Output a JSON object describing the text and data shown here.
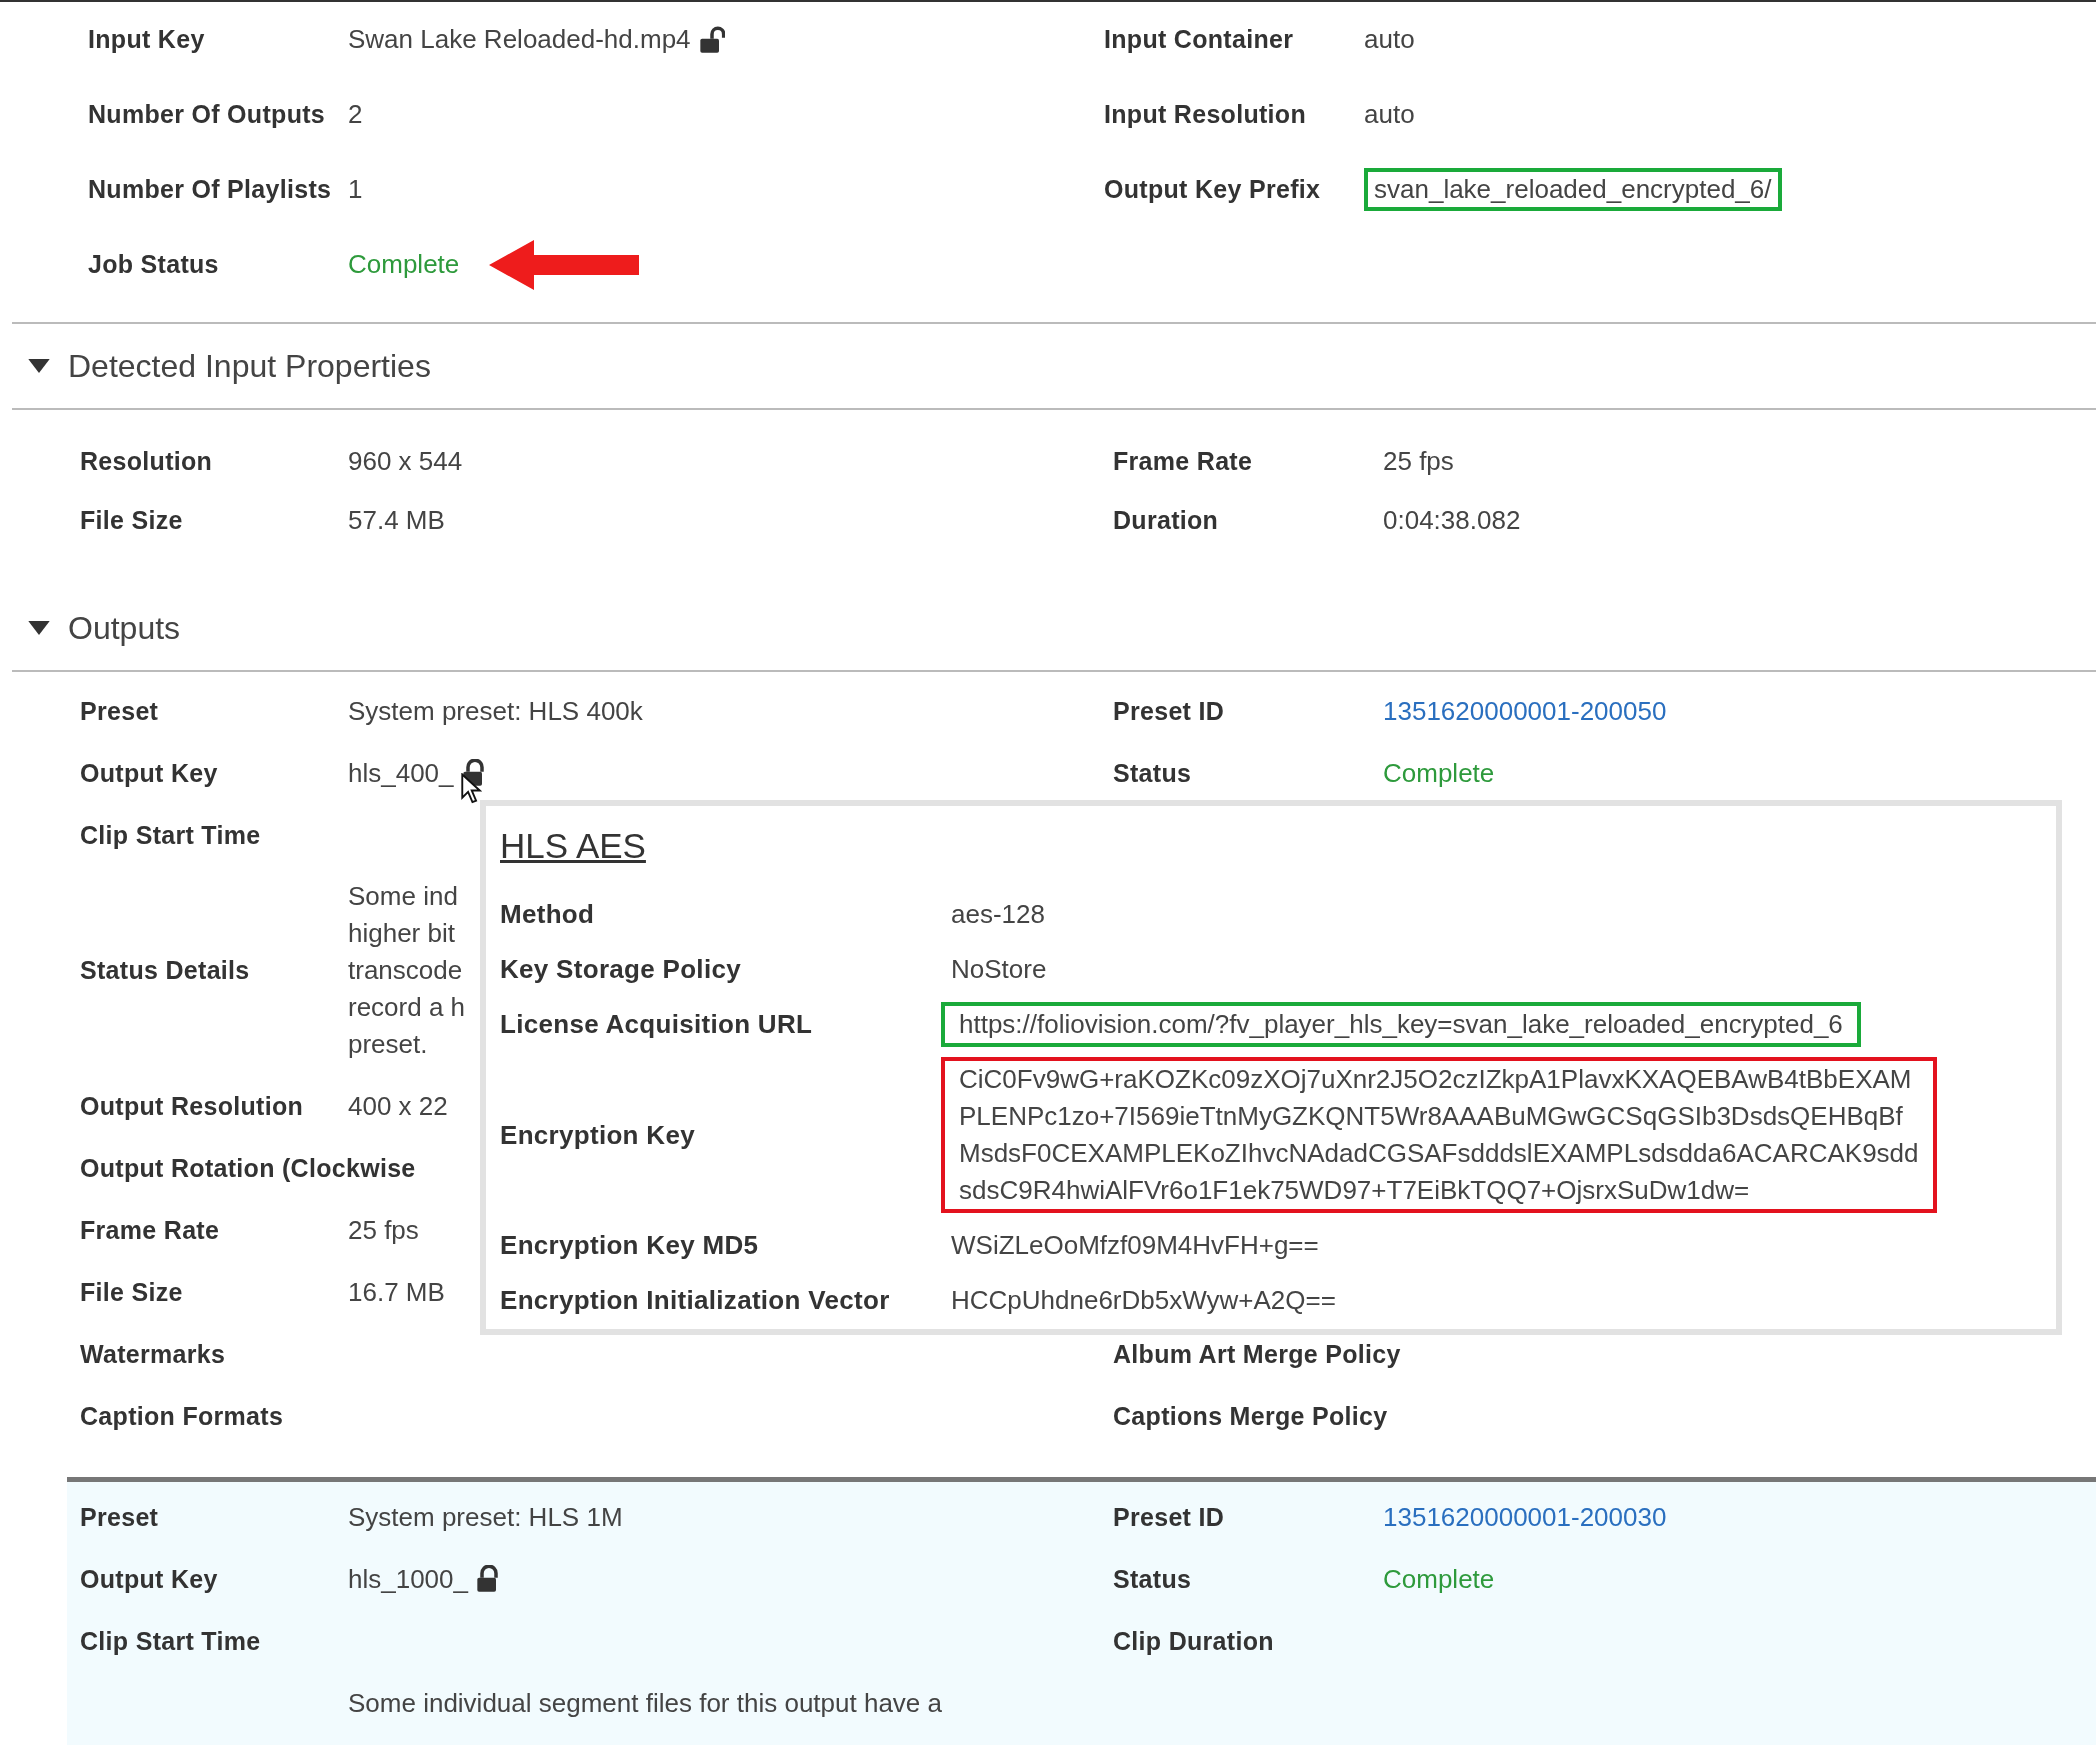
{
  "job": {
    "rows": [
      {
        "left": {
          "label": "Input Key",
          "value": "Swan Lake Reloaded-hd.mp4",
          "kind": "text",
          "lock": {
            "locked": false
          }
        },
        "right": {
          "label": "Input Container",
          "value": "auto",
          "kind": "text"
        }
      },
      {
        "left": {
          "label": "Number Of Outputs",
          "value": "2",
          "kind": "text"
        },
        "right": {
          "label": "Input Resolution",
          "value": "auto",
          "kind": "text"
        }
      },
      {
        "left": {
          "label": "Number Of Playlists",
          "value": "1",
          "kind": "text"
        },
        "right": {
          "label": "Output Key Prefix",
          "value": "svan_lake_reloaded_encrypted_6/",
          "kind": "text",
          "boxed": true,
          "color": "#1aaa3a"
        }
      },
      {
        "left": {
          "label": "Job Status",
          "value": "Complete",
          "kind": "status",
          "arrow": true
        }
      }
    ]
  },
  "sections": [
    {
      "title": "Detected Input Properties",
      "expanded": true
    },
    {
      "title": "Outputs",
      "expanded": true
    }
  ],
  "input_properties": {
    "rows": [
      {
        "left": {
          "label": "Resolution",
          "value": "960 x 544",
          "kind": "text"
        },
        "right": {
          "label": "Frame Rate",
          "value": "25 fps",
          "kind": "text"
        }
      },
      {
        "left": {
          "label": "File Size",
          "value": "57.4 MB",
          "kind": "text"
        },
        "right": {
          "label": "Duration",
          "value": "0:04:38.082",
          "kind": "text"
        }
      }
    ]
  },
  "outputs": [
    {
      "selected": false,
      "rows": [
        {
          "left": {
            "label": "Preset",
            "value": "System preset: HLS 400k",
            "kind": "text"
          },
          "right": {
            "label": "Preset ID",
            "value": "1351620000001-200050",
            "kind": "link"
          }
        },
        {
          "left": {
            "label": "Output Key",
            "value": "hls_400_",
            "kind": "text",
            "lock": {
              "locked": true
            },
            "cursor": true
          },
          "right": {
            "label": "Status",
            "value": "Complete",
            "kind": "status"
          }
        },
        {
          "left": {
            "label": "Clip Start Time"
          }
        },
        {
          "left": {
            "label": "Status Details",
            "lines": [
              "Some ind",
              "higher bit",
              "transcode",
              "record a h",
              "preset."
            ]
          }
        },
        {
          "left": {
            "label": "Output Resolution",
            "value": "400 x 22",
            "kind": "text"
          }
        },
        {
          "left": {
            "label": "Output Rotation (Clockwise"
          }
        },
        {
          "left": {
            "label": "Frame Rate",
            "value": "25 fps",
            "kind": "text"
          }
        },
        {
          "left": {
            "label": "File Size",
            "value": "16.7 MB",
            "kind": "text"
          }
        },
        {
          "left": {
            "label": "Watermarks"
          },
          "right": {
            "label": "Album Art Merge Policy"
          }
        },
        {
          "left": {
            "label": "Caption Formats"
          },
          "right": {
            "label": "Captions Merge Policy"
          }
        }
      ]
    },
    {
      "selected": true,
      "rows": [
        {
          "left": {
            "label": "Preset",
            "value": "System preset: HLS 1M",
            "kind": "text"
          },
          "right": {
            "label": "Preset ID",
            "value": "1351620000001-200030",
            "kind": "link"
          }
        },
        {
          "left": {
            "label": "Output Key",
            "value": "hls_1000_",
            "kind": "text",
            "lock": {
              "locked": true
            }
          },
          "right": {
            "label": "Status",
            "value": "Complete",
            "kind": "status"
          }
        },
        {
          "left": {
            "label": "Clip Start Time"
          },
          "right": {
            "label": "Clip Duration"
          }
        },
        {
          "left": {
            "lines": [
              "Some individual segment files for this output have a"
            ]
          }
        }
      ]
    }
  ],
  "popup": {
    "title": "HLS AES",
    "rows": [
      {
        "label": "Method",
        "lines": [
          "aes-128"
        ]
      },
      {
        "label": "Key Storage Policy",
        "lines": [
          "NoStore"
        ]
      },
      {
        "label": "License Acquisition URL",
        "lines": [
          "https://foliovision.com/?fv_player_hls_key=svan_lake_reloaded_encrypted_6"
        ],
        "boxed": true,
        "color": "#1aaa3a"
      },
      {
        "label": "Encryption Key",
        "lines": [
          "CiC0Fv9wG+raKOZKc09zXOj7uXnr2J5O2czIZkpA1PlavxKXAQEBAwB4tBbEXAM",
          "PLENPc1zo+7I569ieTtnMyGZKQNT5Wr8AAABuMGwGCSqGSIb3DsdsQEHBqBf",
          "MsdsF0CEXAMPLEKoZIhvcNAdadCGSAFsdddslEXAMPLsdsdda6ACARCAK9sdd",
          "sdsC9R4hwiAlFVr6o1F1ek75WD97+T7EiBkTQQ7+OjsrxSuDw1dw="
        ],
        "boxed": true,
        "color": "#e3121e"
      },
      {
        "label": "Encryption Key MD5",
        "lines": [
          "WSiZLeOoMfzf09M4HvFH+g=="
        ]
      },
      {
        "label": "Encryption Initialization Vector",
        "lines": [
          "HCCpUhdne6rDb5xWyw+A2Q=="
        ]
      }
    ]
  }
}
